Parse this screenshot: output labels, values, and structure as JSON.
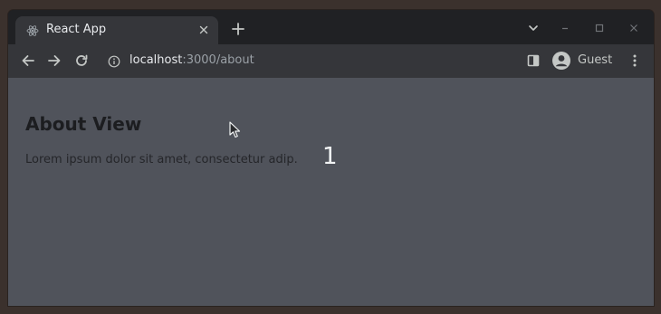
{
  "browser": {
    "tab": {
      "title": "React App",
      "favicon": "react-logo-icon",
      "close_icon": "close-icon"
    },
    "new_tab_icon": "plus-icon",
    "window_controls": [
      "chevron-down-icon",
      "minimize-icon",
      "maximize-icon",
      "close-icon"
    ],
    "toolbar": {
      "back_icon": "arrow-left-icon",
      "forward_icon": "arrow-right-icon",
      "reload_icon": "reload-icon",
      "info_icon": "info-icon",
      "url_host": "localhost",
      "url_rest": ":3000/about",
      "side_panel_icon": "side-panel-icon",
      "profile_icon": "account-circle-icon",
      "profile_label": "Guest",
      "menu_icon": "kebab-menu-icon"
    }
  },
  "page": {
    "heading": "About View",
    "body_text": "Lorem ipsum dolor sit amet, consectetur adip.",
    "counter": "1"
  },
  "colors": {
    "tab_bar": "#202124",
    "toolbar": "#35363a",
    "page_background": "#50535b",
    "text_dark": "#1c1d20"
  }
}
